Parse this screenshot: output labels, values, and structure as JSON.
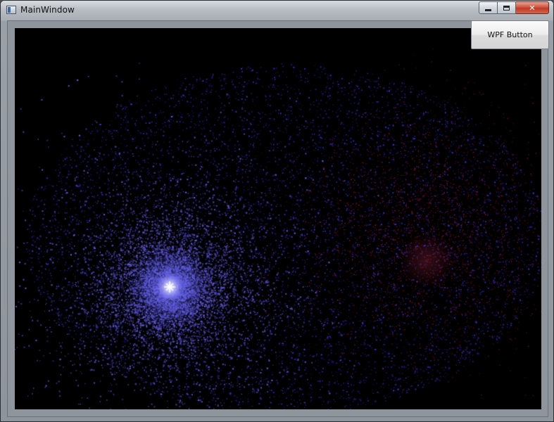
{
  "window": {
    "title": "MainWindow",
    "icon": "app-window-icon",
    "controls": {
      "minimize_icon": "minimize-icon",
      "maximize_icon": "maximize-icon",
      "close_icon": "close-icon",
      "close_glyph": "✕"
    }
  },
  "toolbar": {
    "wpf_button_label": "WPF Button"
  },
  "scene": {
    "background": "#000000",
    "clusters": [
      {
        "name": "blue-cluster",
        "color": "#4a4aff",
        "core_color": "#ffffff"
      },
      {
        "name": "red-cluster",
        "color": "#8a2040"
      }
    ]
  }
}
